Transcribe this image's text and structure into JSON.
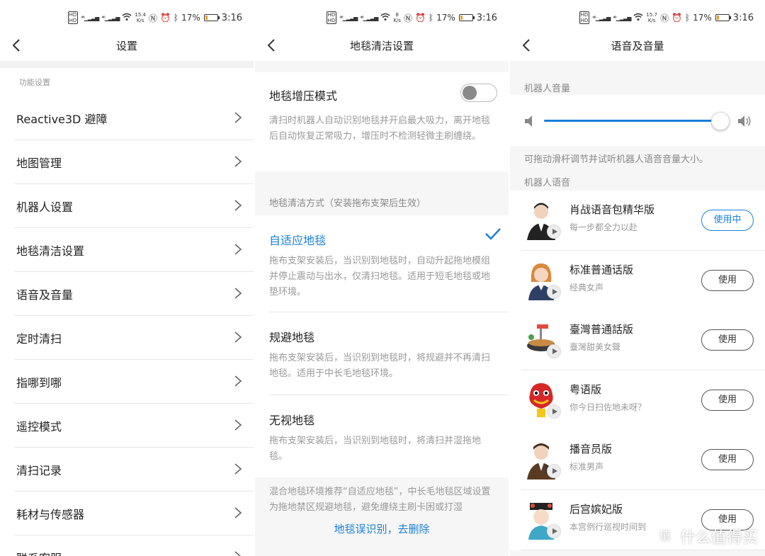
{
  "status_bars": [
    {
      "speed": "15.4",
      "speed_unit": "K/s",
      "battery": "17%",
      "time": "3:16"
    },
    {
      "speed": "8",
      "speed_unit": "K/s",
      "battery": "17%",
      "time": "3:16"
    },
    {
      "speed": "15.7",
      "speed_unit": "K/s",
      "battery": "17%",
      "time": "3:16"
    }
  ],
  "battery_level": 0.17,
  "accent_color": "#1a7fd9",
  "settings": {
    "title": "设置",
    "section": "功能设置",
    "items": [
      {
        "label": "Reactive3D 避障"
      },
      {
        "label": "地图管理"
      },
      {
        "label": "机器人设置"
      },
      {
        "label": "地毯清洁设置"
      },
      {
        "label": "语音及音量"
      },
      {
        "label": "定时清扫"
      },
      {
        "label": "指哪到哪"
      },
      {
        "label": "遥控模式"
      },
      {
        "label": "清扫记录"
      },
      {
        "label": "耗材与传感器"
      },
      {
        "label": "联系客服"
      }
    ]
  },
  "carpet": {
    "title": "地毯清洁设置",
    "boost_label": "地毯增压模式",
    "boost_on": false,
    "boost_desc": "清扫时机器人自动识别地毯并开启最大吸力，离开地毯后自动恢复正常吸力，增压时不检测轻微主刷缠绕。",
    "method_label": "地毯清洁方式（安装拖布支架后生效）",
    "options": [
      {
        "name": "自适应地毯",
        "desc": "拖布支架安装后，当识别到地毯时，自动升起拖地模组并停止震动与出水，仅清扫地毯。适用于短毛地毯或地垫环境。",
        "selected": true
      },
      {
        "name": "规避地毯",
        "desc": "拖布支架安装后，当识别到地毯时，将规避并不再清扫地毯。适用于中长毛地毯环境。",
        "selected": false
      },
      {
        "name": "无视地毯",
        "desc": "拖布支架安装后，当识别到地毯时，将清扫并湿拖地毯。",
        "selected": false
      }
    ],
    "footnote": "混合地毯环境推荐“自适应地毯”，中长毛地毯区域设置为拖地禁区规避地毯，避免缠绕主刷卡困或打湿",
    "link": "地毯误识别，去删除"
  },
  "voice": {
    "title": "语音及音量",
    "volume_label": "机器人音量",
    "volume_level": 0.95,
    "volume_hint": "可拖动滑杆调节并试听机器人语音音量大小。",
    "voice_label": "机器人语音",
    "packs": [
      {
        "name": "肖战语音包精华版",
        "sub": "每一步都全力以赴",
        "button": "使用中",
        "active": true,
        "icon": "man-portrait-icon"
      },
      {
        "name": "标准普通话版",
        "sub": "经典女声",
        "button": "使用",
        "active": false,
        "icon": "woman-avatar-icon"
      },
      {
        "name": "臺灣普通話版",
        "sub": "臺灣甜美女聲",
        "button": "使用",
        "active": false,
        "icon": "taiwan-food-icon"
      },
      {
        "name": "粤语版",
        "sub": "你今日扫佐地未呀？",
        "button": "使用",
        "active": false,
        "icon": "lion-dance-icon"
      },
      {
        "name": "播音员版",
        "sub": "标准男声",
        "button": "使用",
        "active": false,
        "icon": "announcer-avatar-icon"
      },
      {
        "name": "后宫嫔妃版",
        "sub": "本宫例行巡视时间到",
        "button": "使用",
        "active": false,
        "icon": "consort-avatar-icon"
      }
    ]
  },
  "watermark": {
    "text": "什么值得买",
    "logo": "值"
  }
}
